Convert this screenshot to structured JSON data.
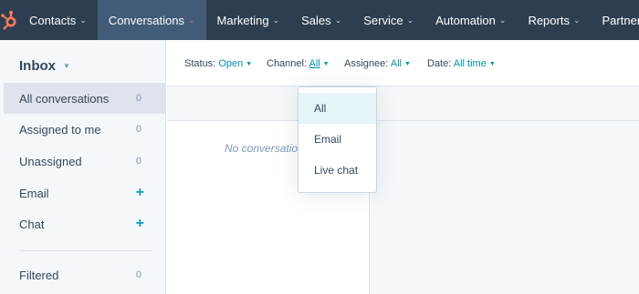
{
  "nav": {
    "items": [
      {
        "label": "Contacts"
      },
      {
        "label": "Conversations"
      },
      {
        "label": "Marketing"
      },
      {
        "label": "Sales"
      },
      {
        "label": "Service"
      },
      {
        "label": "Automation"
      },
      {
        "label": "Reports"
      },
      {
        "label": "Partner"
      }
    ],
    "active": "Conversations",
    "colors": {
      "bar": "#2d3e50",
      "active": "#425b76",
      "logo": "#ff7a59"
    }
  },
  "sidebar": {
    "title": "Inbox",
    "items": [
      {
        "label": "All conversations",
        "count": "0"
      },
      {
        "label": "Assigned to me",
        "count": "0"
      },
      {
        "label": "Unassigned",
        "count": "0"
      },
      {
        "label": "Email",
        "action": "+"
      },
      {
        "label": "Chat",
        "action": "+"
      }
    ],
    "filtered": {
      "label": "Filtered",
      "count": "0"
    }
  },
  "filters": {
    "status": {
      "label": "Status:",
      "value": "Open"
    },
    "channel": {
      "label": "Channel:",
      "value": "All"
    },
    "assignee": {
      "label": "Assignee:",
      "value": "All"
    },
    "date": {
      "label": "Date:",
      "value": "All time"
    }
  },
  "list": {
    "empty_message": "No conversations"
  },
  "channel_dropdown": {
    "options": [
      {
        "label": "All",
        "selected": true
      },
      {
        "label": "Email"
      },
      {
        "label": "Live chat"
      }
    ]
  }
}
